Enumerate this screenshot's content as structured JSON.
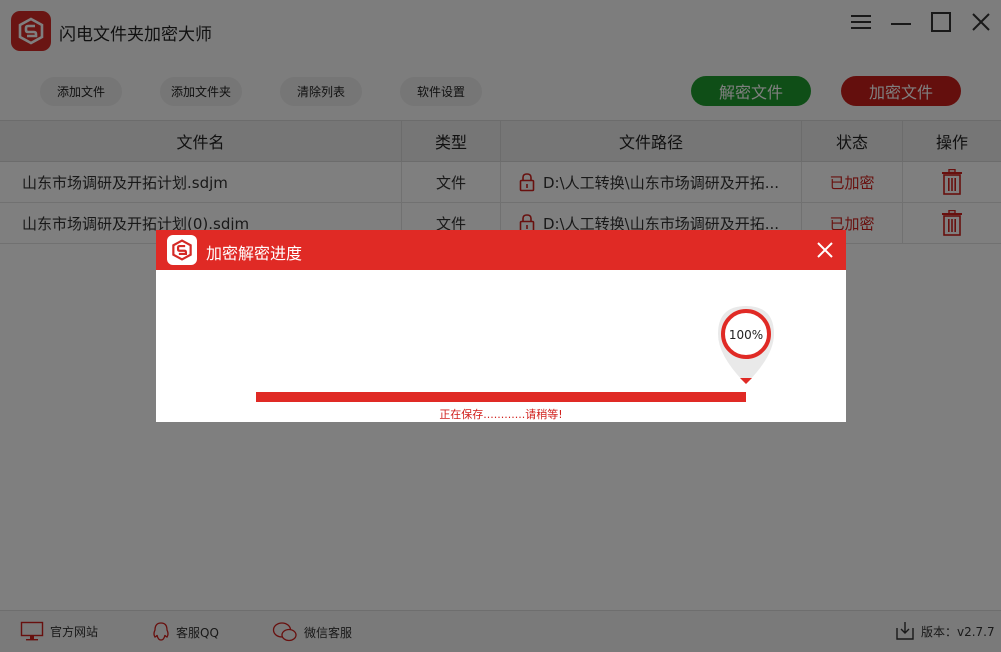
{
  "app": {
    "title": "闪电文件夹加密大师",
    "accent": "#d42a26"
  },
  "toolbar": {
    "add_file": "添加文件",
    "add_folder": "添加文件夹",
    "clear_list": "清除列表",
    "settings": "软件设置",
    "decrypt": "解密文件",
    "encrypt": "加密文件",
    "decrypt_color": "#1f9d2e",
    "encrypt_color": "#c81f1b"
  },
  "table": {
    "headers": [
      "文件名",
      "类型",
      "文件路径",
      "状态",
      "操作"
    ],
    "rows": [
      {
        "name": "山东市场调研及开拓计划.sdjm",
        "type": "文件",
        "path": "D:\\人工转换\\山东市场调研及开拓...",
        "status": "已加密",
        "action": "trash-icon"
      },
      {
        "name": "山东市场调研及开拓计划(0).sdjm",
        "type": "文件",
        "path": "D:\\人工转换\\山东市场调研及开拓...",
        "status": "已加密",
        "action": "trash-icon"
      }
    ]
  },
  "statusbar": {
    "website": "官方网站",
    "qq": "客服QQ",
    "wechat": "微信客服",
    "version": "版本：v2.7.7"
  },
  "dialog": {
    "title": "加密解密进度",
    "progress_percent": 100,
    "progress_label": "100%",
    "status_text": "正在保存............请稍等!"
  }
}
